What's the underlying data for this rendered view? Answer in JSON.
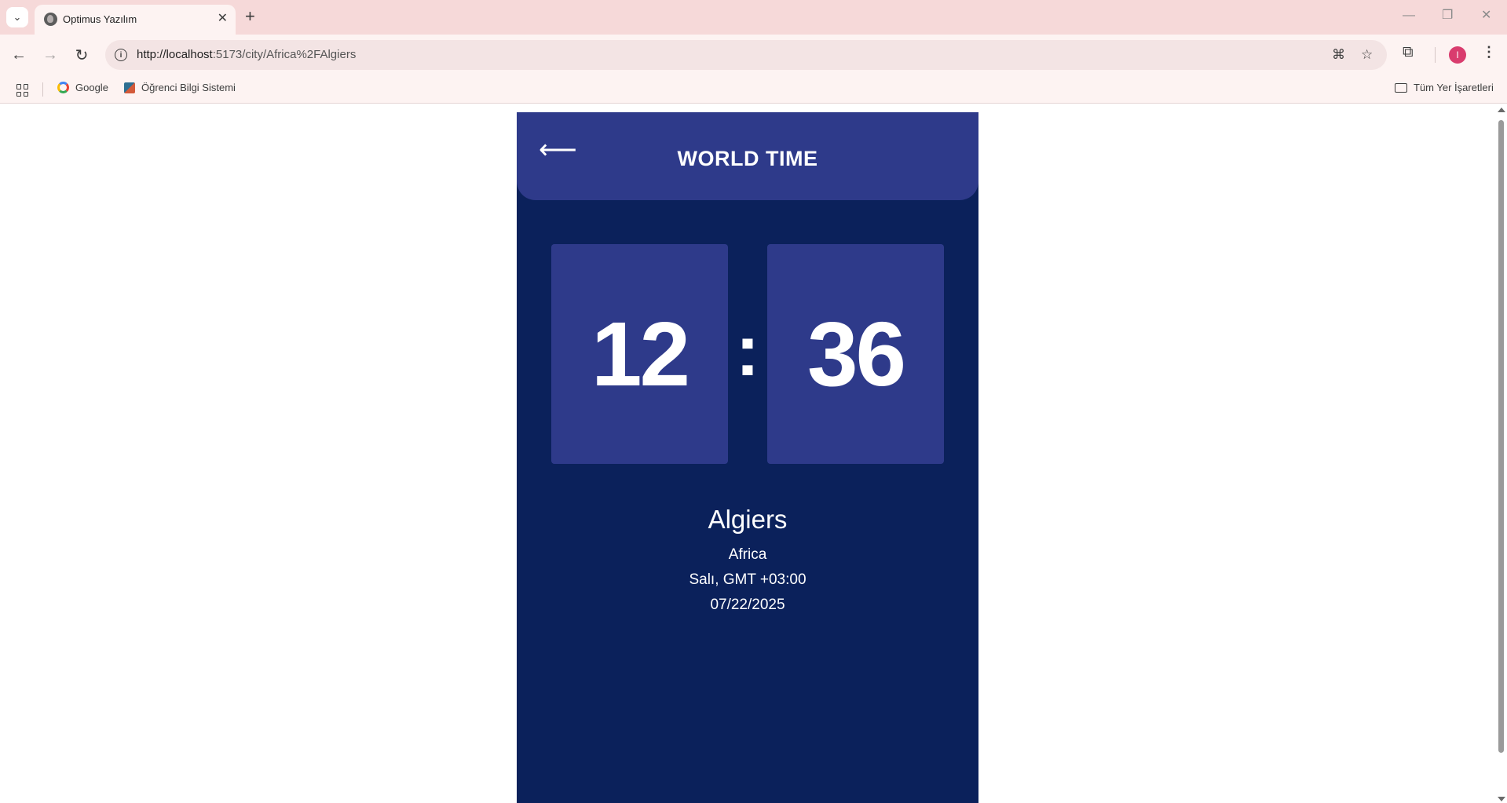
{
  "browser": {
    "tab_title": "Optimus Yazılım",
    "url_host": "http://localhost",
    "url_path": ":5173/city/Africa%2FAlgiers",
    "bookmarks": [
      {
        "label": "Google"
      },
      {
        "label": "Öğrenci Bilgi Sistemi"
      }
    ],
    "all_bookmarks_label": "Tüm Yer İşaretleri",
    "avatar_initial": "I"
  },
  "app": {
    "title": "WORLD TIME",
    "back_icon": "left-arrow-icon",
    "hours": "12",
    "separator": ":",
    "minutes": "36",
    "city": "Algiers",
    "region": "Africa",
    "day_offset": "Salı, GMT +03:00",
    "date": "07/22/2025"
  },
  "colors": {
    "page_bg": "#0b215b",
    "card_bg": "#2e3a8a",
    "browser_tabbar": "#f6d9d9"
  }
}
